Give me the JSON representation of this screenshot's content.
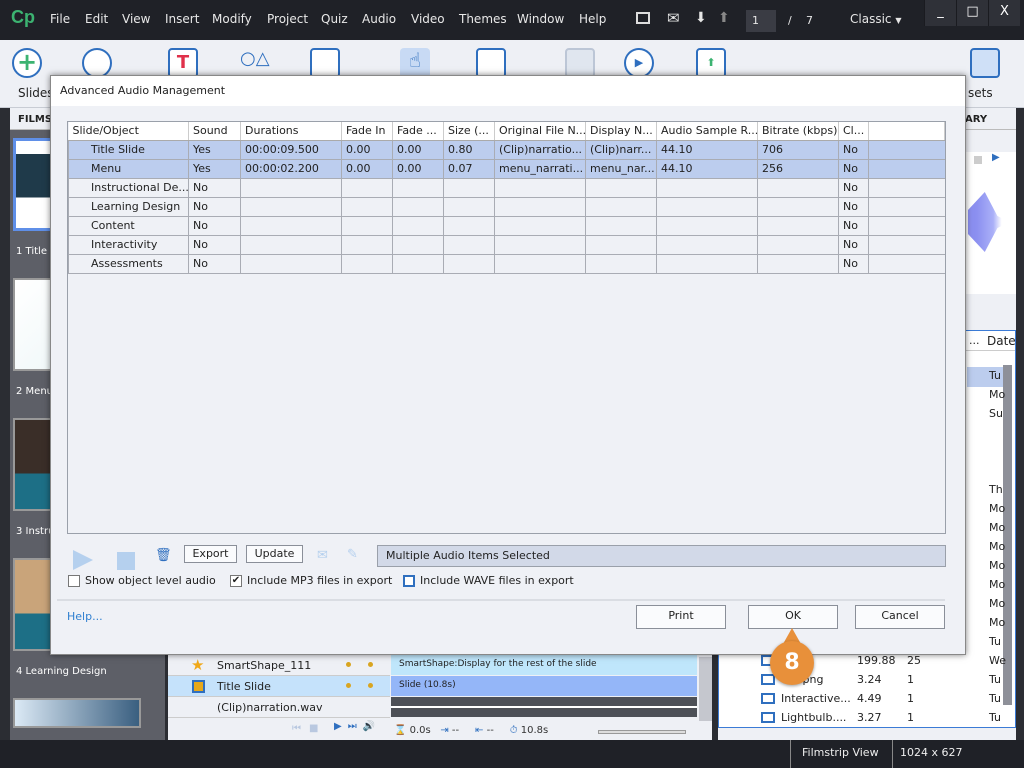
{
  "app": {
    "logo": "Cp",
    "menu": [
      "File",
      "Edit",
      "View",
      "Insert",
      "Modify",
      "Project",
      "Quiz",
      "Audio",
      "Video",
      "Themes",
      "Window",
      "Help"
    ],
    "page_current": "1",
    "page_sep": "/",
    "page_total": "7",
    "workspace": "Classic",
    "window_controls": [
      "_",
      "□",
      "X"
    ]
  },
  "toolbar": {
    "slides_label": "Slides",
    "assets_label": "sets"
  },
  "panels": {
    "filmstrip_header": "FILMST",
    "library_header": "ARY"
  },
  "filmstrip": [
    {
      "label": "1 Title S"
    },
    {
      "label": "2 Menu"
    },
    {
      "label": "3 Instru"
    },
    {
      "label": "4 Learning Design"
    }
  ],
  "library": {
    "date_header": "Date",
    "col_trunc": "...",
    "dates": [
      "Tu",
      "Mo",
      "Su",
      "Th",
      "Mo",
      "Mo",
      "Mo",
      "Mo",
      "Mo",
      "Mo",
      "Mo",
      "Tu",
      "We",
      "Tu",
      "Tu",
      "Tu"
    ],
    "items": [
      {
        "name": "g",
        "size": "199.88",
        "uses": "25"
      },
      {
        "name": "ent.png",
        "size": "3.24",
        "uses": "1"
      },
      {
        "name": "Interactive...",
        "size": "4.49",
        "uses": "1"
      },
      {
        "name": "Lightbulb....",
        "size": "3.27",
        "uses": "1"
      }
    ]
  },
  "timeline": {
    "rows": [
      {
        "name": "SmartShape_111",
        "bar": "SmartShape:Display for the rest of the slide"
      },
      {
        "name": "Title Slide",
        "bar": "Slide (10.8s)"
      },
      {
        "name": "(Clip)narration.wav",
        "bar": ""
      }
    ],
    "time_start": "0.0s",
    "time_in": "--",
    "time_out": "--",
    "duration": "10.8s"
  },
  "status": {
    "view": "Filmstrip View",
    "size": "1024 x 627"
  },
  "dialog": {
    "title": "Advanced Audio Management",
    "columns": [
      "Slide/Object",
      "Sound",
      "Durations",
      "Fade In",
      "Fade ...",
      "Size (...",
      "Original File N...",
      "Display N...",
      "Audio Sample R...",
      "Bitrate (kbps)",
      "Cl..."
    ],
    "rows": [
      [
        "Title Slide",
        "Yes",
        "00:00:09.500",
        "0.00",
        "0.00",
        "0.80",
        "(Clip)narratio...",
        "(Clip)narr...",
        "44.10",
        "706",
        "No"
      ],
      [
        "Menu",
        "Yes",
        "00:00:02.200",
        "0.00",
        "0.00",
        "0.07",
        "menu_narrati...",
        "menu_nar...",
        "44.10",
        "256",
        "No"
      ],
      [
        "Instructional De...",
        "No",
        "",
        "",
        "",
        "",
        "",
        "",
        "",
        "",
        "No"
      ],
      [
        "Learning Design",
        "No",
        "",
        "",
        "",
        "",
        "",
        "",
        "",
        "",
        "No"
      ],
      [
        "Content",
        "No",
        "",
        "",
        "",
        "",
        "",
        "",
        "",
        "",
        "No"
      ],
      [
        "Interactivity",
        "No",
        "",
        "",
        "",
        "",
        "",
        "",
        "",
        "",
        "No"
      ],
      [
        "Assessments",
        "No",
        "",
        "",
        "",
        "",
        "",
        "",
        "",
        "",
        "No"
      ]
    ],
    "selected_rows": [
      0,
      1
    ],
    "export_label": "Export",
    "update_label": "Update",
    "status_field": "Multiple Audio Items Selected",
    "checkboxes": [
      {
        "label": "Show object level audio",
        "checked": false
      },
      {
        "label": "Include MP3 files in export",
        "checked": true
      },
      {
        "label": "Include WAVE files in export",
        "checked": false
      }
    ],
    "help_link": "Help...",
    "print_label": "Print",
    "ok_label": "OK",
    "cancel_label": "Cancel"
  },
  "callout": {
    "number": "8",
    "color": "#e8903a"
  },
  "colors": {
    "selection": "#bccdee",
    "accent": "#2f6fbf"
  }
}
